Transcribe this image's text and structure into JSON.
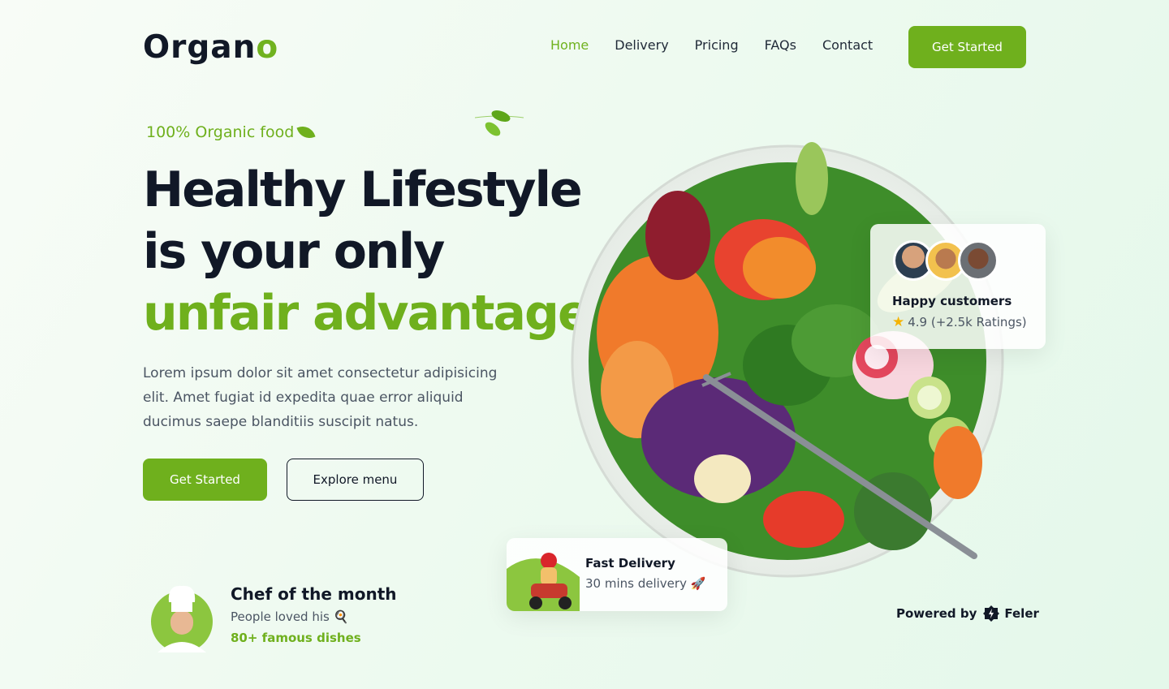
{
  "header": {
    "logo_main": "Organ",
    "logo_accent": "o",
    "nav": [
      "Home",
      "Delivery",
      "Pricing",
      "FAQs",
      "Contact"
    ],
    "cta": "Get Started"
  },
  "hero": {
    "tagline": "100% Organic food",
    "headline_line1": "Healthy Lifestyle",
    "headline_line2": "is your only",
    "headline_line3": "unfair advantage",
    "description": "Lorem ipsum dolor sit amet consectetur adipisicing elit. Amet fugiat id expedita quae error aliquid ducimus saepe blanditiis suscipit natus.",
    "primary_button": "Get Started",
    "secondary_button": "Explore menu"
  },
  "chef": {
    "title": "Chef of the month",
    "subtitle": "People loved his",
    "count": "80+ famous dishes"
  },
  "customers_card": {
    "title": "Happy customers",
    "rating": "4.9 (+2.5k Ratings)"
  },
  "delivery_card": {
    "title": "Fast Delivery",
    "subtitle": "30 mins delivery"
  },
  "footer": {
    "powered_by": "Powered by",
    "brand": "Feler"
  },
  "colors": {
    "accent": "#6fb01d",
    "text": "#111827",
    "muted": "#4b5563"
  }
}
